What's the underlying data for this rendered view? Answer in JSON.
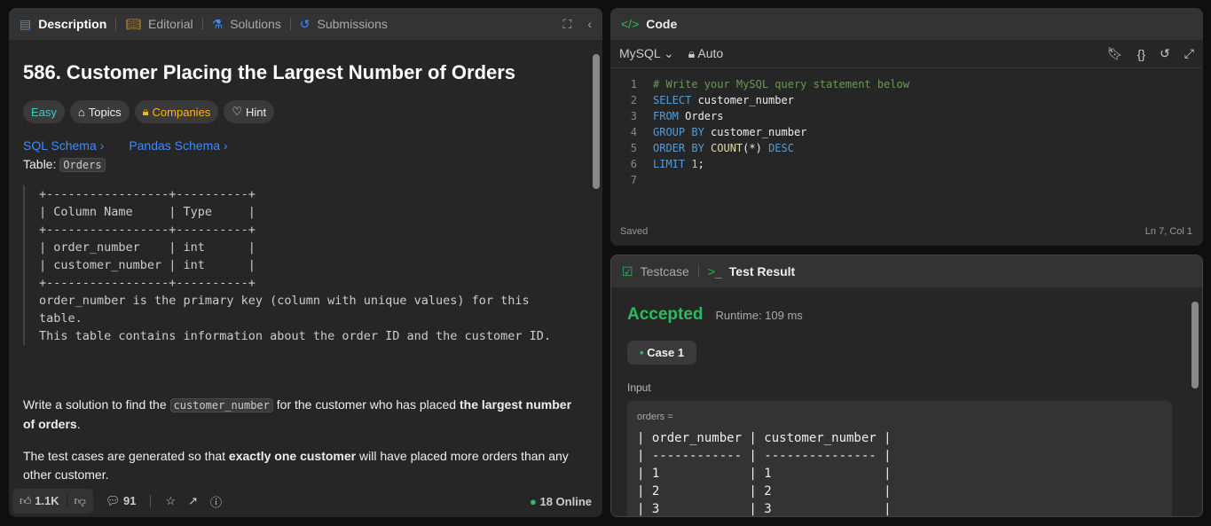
{
  "left": {
    "tabs": [
      "Description",
      "Editorial",
      "Solutions",
      "Submissions"
    ],
    "title": "586. Customer Placing the Largest Number of Orders",
    "tags": {
      "difficulty": "Easy",
      "topics": "Topics",
      "companies": "Companies",
      "hint": "Hint"
    },
    "links": [
      "SQL Schema",
      "Pandas Schema"
    ],
    "table_label": "Table:",
    "table_name": "Orders",
    "schema": "+-----------------+----------+\n| Column Name     | Type     |\n+-----------------+----------+\n| order_number    | int      |\n| customer_number | int      |\n+-----------------+----------+\norder_number is the primary key (column with unique values) for this\ntable.\nThis table contains information about the order ID and the customer ID.",
    "p1_a": "Write a solution to find the ",
    "p1_code": "customer_number",
    "p1_b": " for the customer who has placed ",
    "p1_bold": "the largest number of orders",
    "p1_c": ".",
    "p2_a": "The test cases are generated so that ",
    "p2_bold": "exactly one customer",
    "p2_b": " will have placed more orders than any other customer.",
    "footer": {
      "likes": "1.1K",
      "comments": "91",
      "online": "18 Online"
    }
  },
  "code": {
    "title": "Code",
    "language": "MySQL",
    "auto": "Auto",
    "status": "Saved",
    "cursor": "Ln 7, Col 1",
    "lines": [
      "# Write your MySQL query statement below",
      "SELECT customer_number",
      "FROM Orders",
      "GROUP BY customer_number",
      "ORDER BY COUNT(*) DESC",
      "LIMIT 1;",
      ""
    ]
  },
  "result": {
    "tabs": [
      "Testcase",
      "Test Result"
    ],
    "status": "Accepted",
    "runtime": "Runtime: 109 ms",
    "case": "Case 1",
    "input_label": "Input",
    "var": "orders =",
    "table": "| order_number | customer_number |\n| ------------ | --------------- |\n| 1            | 1               |\n| 2            | 2               |\n| 3            | 3               |"
  },
  "colors": {
    "accent": "#2cbb5d",
    "link": "#3b8cff",
    "easy": "#46c6c2",
    "companies": "#ffb800"
  }
}
